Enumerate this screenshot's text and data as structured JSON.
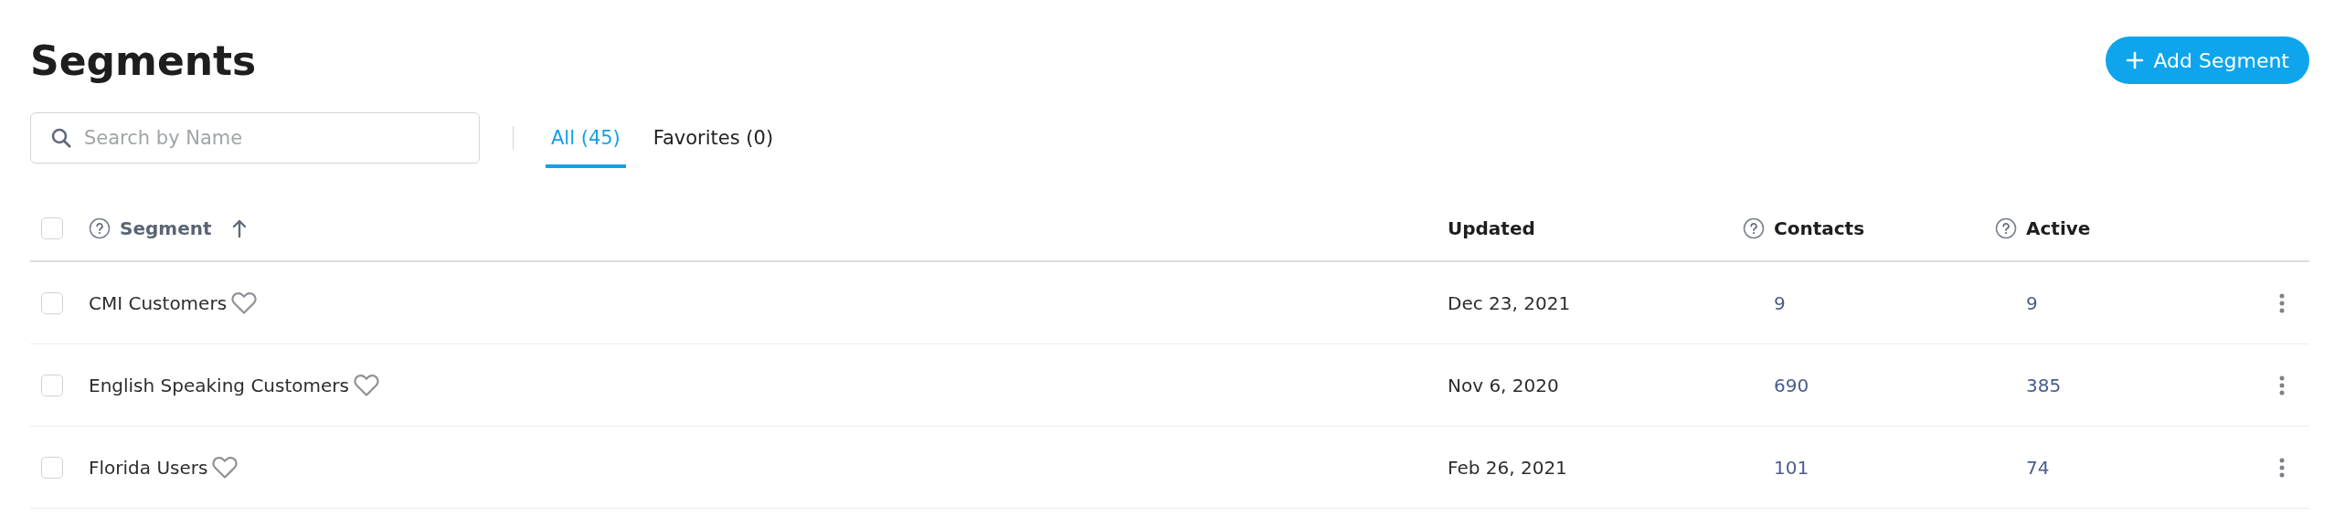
{
  "title": "Segments",
  "add_button": {
    "label": "Add Segment"
  },
  "search": {
    "placeholder": "Search by Name"
  },
  "tabs": [
    {
      "label": "All (45)",
      "selected": true
    },
    {
      "label": "Favorites (0)",
      "selected": false
    }
  ],
  "table": {
    "select_all": {
      "checked": false
    },
    "columns": [
      {
        "label": "Segment",
        "help": true,
        "sorted": true
      },
      {
        "label": "Updated",
        "help": false,
        "sorted": false
      },
      {
        "label": "Contacts",
        "help": true,
        "sorted": false
      },
      {
        "label": "Active",
        "help": true,
        "sorted": false
      }
    ],
    "rows": [
      {
        "name": "CMI Customers",
        "favorite": false,
        "checked": false,
        "updated": "Dec 23, 2021",
        "contacts": "9",
        "active": "9"
      },
      {
        "name": "English Speaking Customers",
        "favorite": false,
        "checked": false,
        "updated": "Nov 6, 2020",
        "contacts": "690",
        "active": "385"
      },
      {
        "name": "Florida Users",
        "favorite": false,
        "checked": false,
        "updated": "Feb 26, 2021",
        "contacts": "101",
        "active": "74"
      }
    ]
  }
}
